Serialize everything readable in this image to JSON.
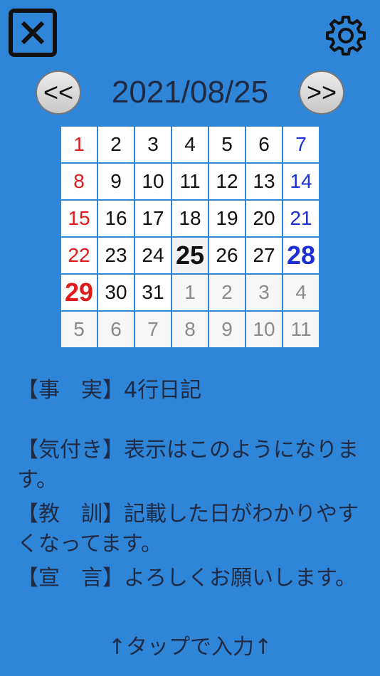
{
  "header": {
    "close_icon": "close-icon",
    "settings_icon": "gear-icon"
  },
  "nav": {
    "prev_label": "<<",
    "next_label": ">>",
    "date": "2021/08/25"
  },
  "calendar": {
    "colors": {
      "sunday": "#e01b1b",
      "saturday": "#1b2fd4",
      "outside": "#8a8a8a"
    },
    "weeks": [
      [
        "1",
        "2",
        "3",
        "4",
        "5",
        "6",
        "7"
      ],
      [
        "8",
        "9",
        "10",
        "11",
        "12",
        "13",
        "14"
      ],
      [
        "15",
        "16",
        "17",
        "18",
        "19",
        "20",
        "21"
      ],
      [
        "22",
        "23",
        "24",
        "25",
        "26",
        "27",
        "28"
      ],
      [
        "29",
        "30",
        "31",
        "1",
        "2",
        "3",
        "4"
      ],
      [
        "5",
        "6",
        "7",
        "8",
        "9",
        "10",
        "11"
      ]
    ]
  },
  "notes": {
    "fact": "【事　実】4行日記",
    "awareness": "【気付き】表示はこのようになります。",
    "lesson": "【教　訓】記載した日がわかりやすくなってます。",
    "declaration": "【宣　言】よろしくお願いします。"
  },
  "footer": {
    "tap_hint": "↑タップで入力↑"
  }
}
